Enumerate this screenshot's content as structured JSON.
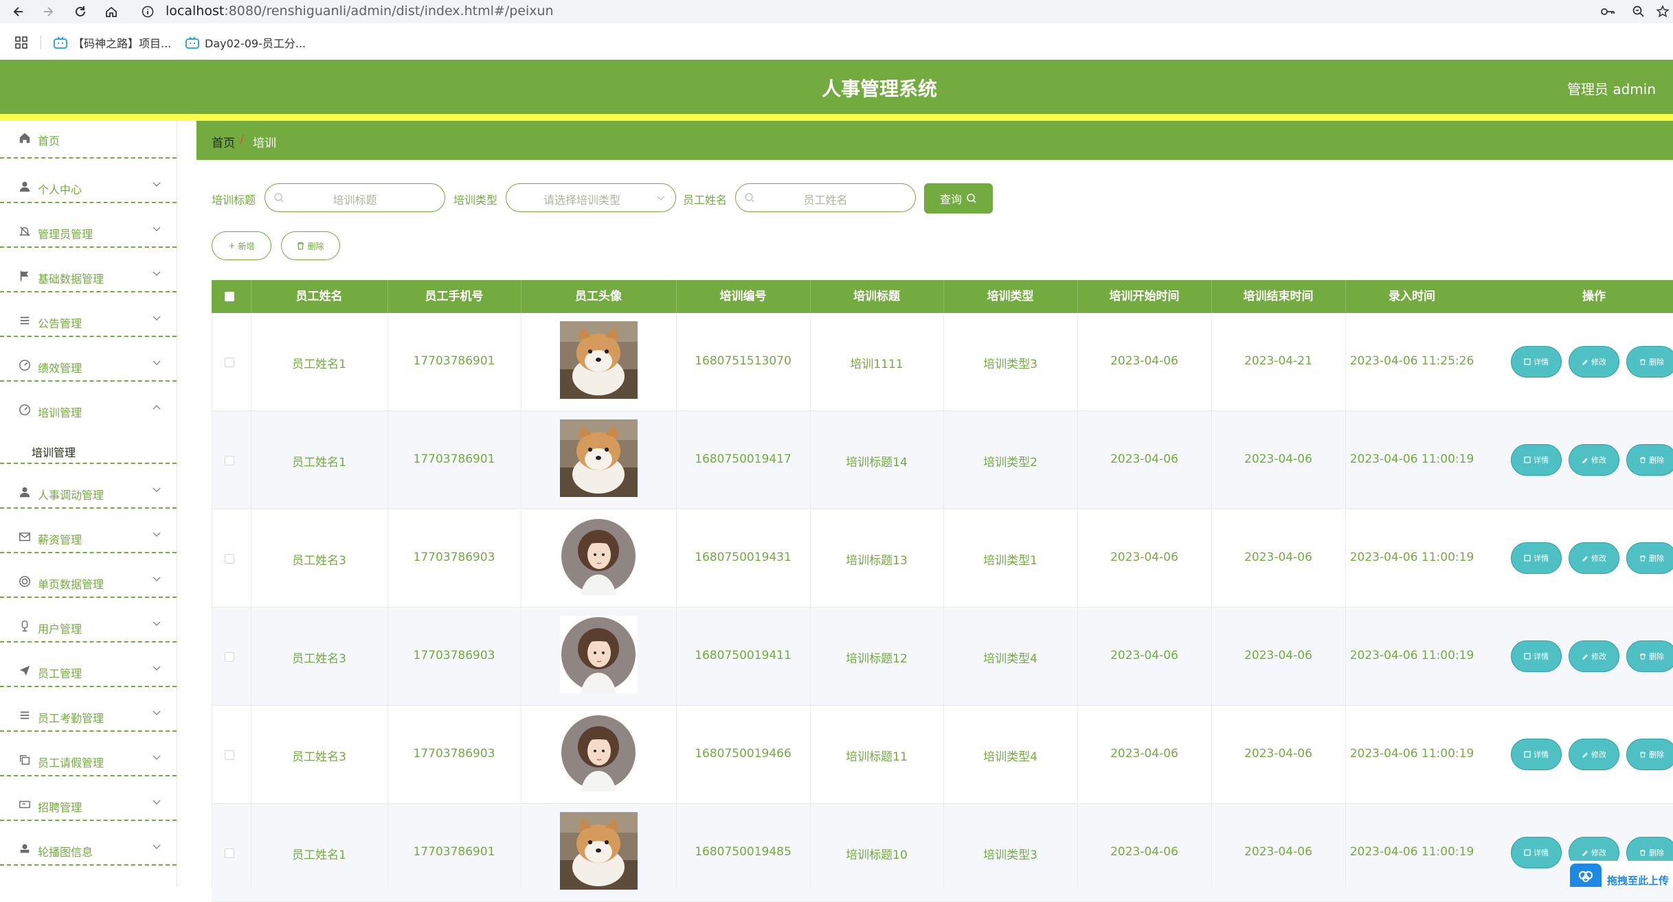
{
  "browser": {
    "url_host": "localhost",
    "url_rest": ":8080/renshiguanli/admin/dist/index.html#/peixun",
    "bookmarks": [
      "【码神之路】项目...",
      "Day02-09-员工分..."
    ]
  },
  "header": {
    "title": "人事管理系统",
    "user": "管理员 admin"
  },
  "colors": {
    "primary": "#73ab40",
    "stripe": "#fafc4a",
    "action": "#4fc0c3"
  },
  "sidebar": {
    "items": [
      {
        "label": "首页",
        "icon": "home-icon"
      },
      {
        "label": "个人中心",
        "icon": "user-icon"
      },
      {
        "label": "管理员管理",
        "icon": "bell-icon"
      },
      {
        "label": "基础数据管理",
        "icon": "flag-icon"
      },
      {
        "label": "公告管理",
        "icon": "list-icon"
      },
      {
        "label": "绩效管理",
        "icon": "gauge-icon"
      },
      {
        "label": "培训管理",
        "icon": "gauge-icon",
        "expanded": true,
        "sub": "培训管理"
      },
      {
        "label": "人事调动管理",
        "icon": "user-icon"
      },
      {
        "label": "薪资管理",
        "icon": "mail-icon"
      },
      {
        "label": "单页数据管理",
        "icon": "target-icon"
      },
      {
        "label": "用户管理",
        "icon": "microphone-icon"
      },
      {
        "label": "员工管理",
        "icon": "send-icon"
      },
      {
        "label": "员工考勤管理",
        "icon": "list-icon"
      },
      {
        "label": "员工请假管理",
        "icon": "copy-icon"
      },
      {
        "label": "招聘管理",
        "icon": "ticket-icon"
      },
      {
        "label": "轮播图信息",
        "icon": "stamp-icon"
      }
    ]
  },
  "breadcrumb": {
    "home": "首页",
    "sep": "/",
    "current": "培训"
  },
  "filters": {
    "title_label": "培训标题",
    "title_placeholder": "培训标题",
    "type_label": "培训类型",
    "type_placeholder": "请选择培训类型",
    "name_label": "员工姓名",
    "name_placeholder": "员工姓名",
    "query": "查询"
  },
  "actions": {
    "add": "新增",
    "delete": "删除"
  },
  "table": {
    "headers": [
      "员工姓名",
      "员工手机号",
      "员工头像",
      "培训编号",
      "培训标题",
      "培训类型",
      "培训开始时间",
      "培训结束时间",
      "录入时间",
      "操作"
    ],
    "rows": [
      {
        "name": "员工姓名1",
        "phone": "17703786901",
        "avatar": "dog",
        "code": "1680751513070",
        "title": "培训1111",
        "type": "培训类型3",
        "start": "2023-04-06",
        "end": "2023-04-21",
        "created": "2023-04-06 11:25:26"
      },
      {
        "name": "员工姓名1",
        "phone": "17703786901",
        "avatar": "dog",
        "code": "1680750019417",
        "title": "培训标题14",
        "type": "培训类型2",
        "start": "2023-04-06",
        "end": "2023-04-06",
        "created": "2023-04-06 11:00:19"
      },
      {
        "name": "员工姓名3",
        "phone": "17703786903",
        "avatar": "girl",
        "code": "1680750019431",
        "title": "培训标题13",
        "type": "培训类型1",
        "start": "2023-04-06",
        "end": "2023-04-06",
        "created": "2023-04-06 11:00:19"
      },
      {
        "name": "员工姓名3",
        "phone": "17703786903",
        "avatar": "girl",
        "code": "1680750019411",
        "title": "培训标题12",
        "type": "培训类型4",
        "start": "2023-04-06",
        "end": "2023-04-06",
        "created": "2023-04-06 11:00:19"
      },
      {
        "name": "员工姓名3",
        "phone": "17703786903",
        "avatar": "girl",
        "code": "1680750019466",
        "title": "培训标题11",
        "type": "培训类型4",
        "start": "2023-04-06",
        "end": "2023-04-06",
        "created": "2023-04-06 11:00:19"
      },
      {
        "name": "员工姓名1",
        "phone": "17703786901",
        "avatar": "dog",
        "code": "1680750019485",
        "title": "培训标题10",
        "type": "培训类型3",
        "start": "2023-04-06",
        "end": "2023-04-06",
        "created": "2023-04-06 11:00:19"
      }
    ],
    "row_actions": {
      "detail": "详情",
      "edit": "修改",
      "delete": "删除"
    }
  },
  "upload_widget": {
    "label": "拖拽至此上传"
  }
}
